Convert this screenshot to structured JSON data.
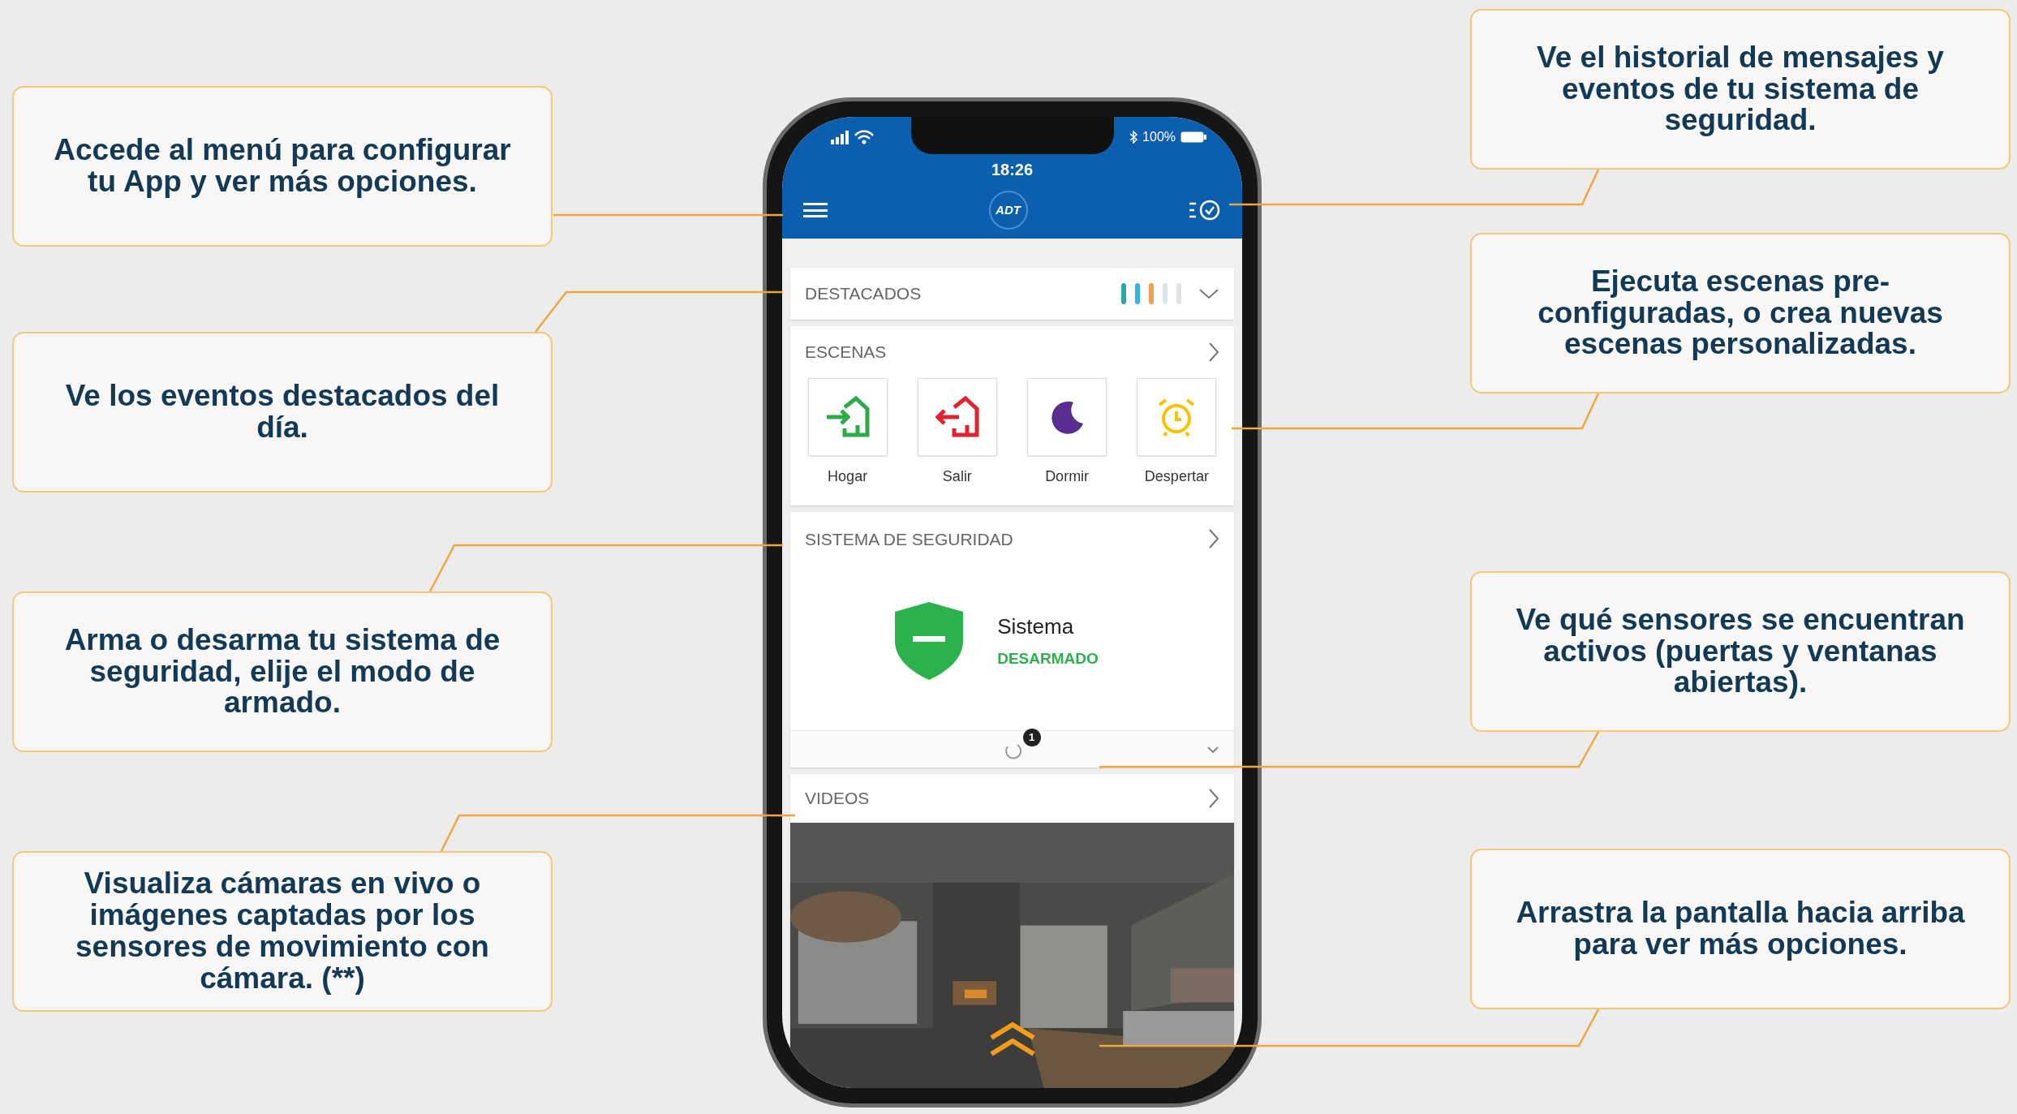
{
  "callouts_left": [
    {
      "text": "Accede al menú para configurar tu App y ver más opciones."
    },
    {
      "text": "Ve los eventos destacados del día."
    },
    {
      "text": "Arma o desarma tu sistema de seguridad, elije el modo de armado."
    },
    {
      "text": "Visualiza cámaras en vivo o imágenes captadas por los sensores de movimiento con cámara. (**)"
    }
  ],
  "callouts_right": [
    {
      "text": "Ve el historial de mensajes y eventos de tu sistema de seguridad."
    },
    {
      "text": "Ejecuta escenas pre-configuradas, o crea nuevas escenas personalizadas."
    },
    {
      "text": "Ve qué sensores se encuentran activos (puertas y ventanas abiertas)."
    },
    {
      "text": "Arrastra la pantalla hacia arriba para ver más opciones."
    }
  ],
  "phone": {
    "status_bar": {
      "battery": "100%",
      "time": "18:26"
    },
    "header": {
      "logo": "ADT"
    },
    "highlights": {
      "title": "DESTACADOS",
      "expanded": false
    },
    "scenes": {
      "title": "ESCENAS",
      "items": [
        {
          "kind": "home",
          "label": "Hogar"
        },
        {
          "kind": "leave",
          "label": "Salir"
        },
        {
          "kind": "sleep",
          "label": "Dormir"
        },
        {
          "kind": "wake",
          "label": "Despertar"
        }
      ]
    },
    "security": {
      "title": "SISTEMA DE SEGURIDAD",
      "label": "Sistema",
      "armed": false,
      "state": "DESARMADO",
      "badge": "1"
    },
    "videos": {
      "title": "VIDEOS"
    }
  }
}
